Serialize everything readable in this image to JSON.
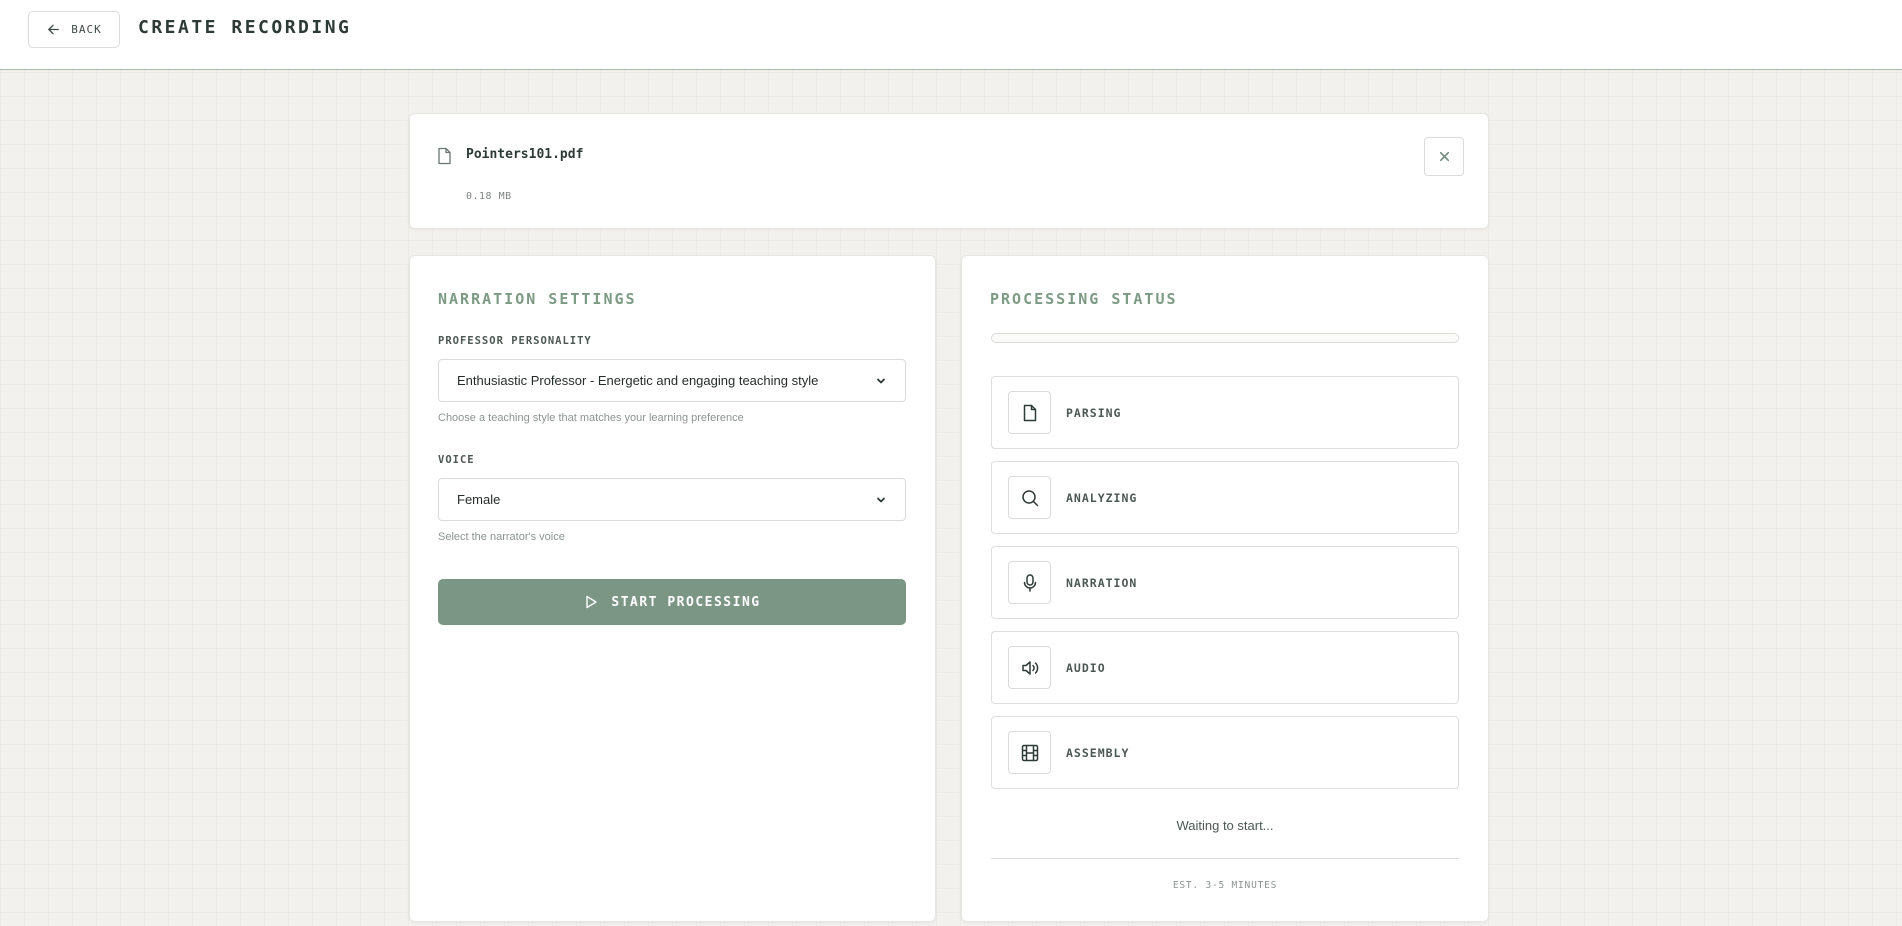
{
  "header": {
    "back_label": "BACK",
    "title": "CREATE RECORDING"
  },
  "file": {
    "name": "Pointers101.pdf",
    "size": "0.18 MB"
  },
  "settings": {
    "title": "NARRATION SETTINGS",
    "personality": {
      "label": "PROFESSOR PERSONALITY",
      "value": "Enthusiastic Professor - Energetic and engaging teaching style",
      "help": "Choose a teaching style that matches your learning preference"
    },
    "voice": {
      "label": "VOICE",
      "value": "Female",
      "help": "Select the narrator's voice"
    },
    "start_label": "START PROCESSING"
  },
  "status": {
    "title": "PROCESSING STATUS",
    "progress": 0,
    "stages": [
      {
        "label": "PARSING",
        "icon": "file-icon"
      },
      {
        "label": "ANALYZING",
        "icon": "search-icon"
      },
      {
        "label": "NARRATION",
        "icon": "microphone-icon"
      },
      {
        "label": "AUDIO",
        "icon": "speaker-icon"
      },
      {
        "label": "ASSEMBLY",
        "icon": "film-icon"
      }
    ],
    "message": "Waiting to start...",
    "estimate": "EST. 3-5 MINUTES"
  },
  "colors": {
    "accent": "#7c9685",
    "title_green": "#7c9a84",
    "header_border": "#a9bca9",
    "background": "#f3f1ed"
  }
}
